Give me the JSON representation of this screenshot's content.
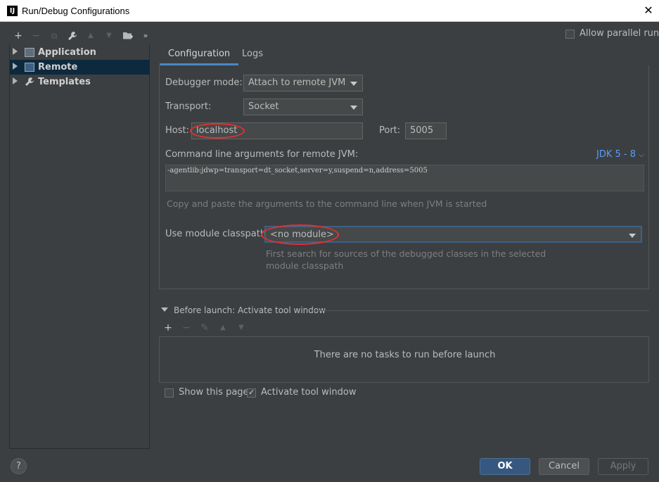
{
  "window": {
    "title": "Run/Debug Configurations",
    "app_icon": "IJ",
    "close_icon": "✕"
  },
  "toolbar": {
    "add": "+",
    "remove": "−",
    "copy": "⧉",
    "edit": "🔧",
    "up": "▲",
    "down": "▼",
    "folder": "📁",
    "more": "»"
  },
  "allow_parallel": {
    "label": "Allow parallel run",
    "checked": false
  },
  "tree": {
    "items": [
      {
        "label": "Application",
        "selected": false
      },
      {
        "label": "Remote",
        "selected": true
      },
      {
        "label": "Templates",
        "selected": false
      }
    ]
  },
  "tabs": [
    {
      "label": "Configuration",
      "active": true
    },
    {
      "label": "Logs",
      "active": false
    }
  ],
  "config": {
    "debugger_mode_label": "Debugger mode:",
    "debugger_mode_value": "Attach to remote JVM",
    "transport_label": "Transport:",
    "transport_value": "Socket",
    "host_label": "Host:",
    "host_value": "localhost",
    "port_label": "Port:",
    "port_value": "5005",
    "cmd_label": "Command line arguments for remote JVM:",
    "jdk_link": "JDK 5 - 8",
    "cmd_value": "-agentlib:jdwp=transport=dt_socket,server=y,suspend=n,address=5005",
    "cmd_hint": "Copy and paste the arguments to the command line when JVM is started",
    "module_label": "Use module classpath:",
    "module_value": "<no module>",
    "module_hint_1": "First search for sources of the debugged classes in the selected",
    "module_hint_2": "module classpath"
  },
  "before_launch": {
    "title": "Before launch: Activate tool window",
    "toolbar": {
      "add": "+",
      "remove": "−",
      "edit": "✎",
      "up": "▲",
      "down": "▼"
    },
    "empty_text": "There are no tasks to run before launch"
  },
  "show_this_page": {
    "label": "Show this page",
    "checked": false
  },
  "activate_tool_window": {
    "label": "Activate tool window",
    "checked": true
  },
  "buttons": {
    "help": "?",
    "ok": "OK",
    "cancel": "Cancel",
    "apply": "Apply"
  },
  "colors": {
    "accent": "#4a88c7",
    "selection": "#0d293e",
    "link": "#589df6",
    "annotation": "#e53030"
  }
}
